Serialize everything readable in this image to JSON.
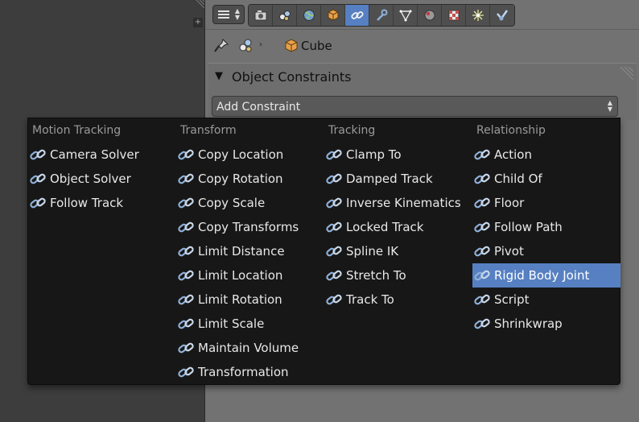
{
  "header": {
    "tabs": [
      {
        "icon": "render-icon"
      },
      {
        "icon": "render-layers-icon"
      },
      {
        "icon": "world-icon"
      },
      {
        "icon": "object-icon"
      },
      {
        "icon": "constraint-icon",
        "active": true
      },
      {
        "icon": "modifier-icon"
      },
      {
        "icon": "mesh-data-icon"
      },
      {
        "icon": "material-icon"
      },
      {
        "icon": "texture-icon"
      },
      {
        "icon": "particles-icon"
      },
      {
        "icon": "physics-icon"
      }
    ]
  },
  "breadcrumb": {
    "object_name": "Cube"
  },
  "panel": {
    "title": "Object Constraints",
    "add_constraint_label": "Add Constraint"
  },
  "menu": {
    "columns": [
      {
        "header": "Motion Tracking",
        "items": [
          "Camera Solver",
          "Object Solver",
          "Follow Track"
        ]
      },
      {
        "header": "Transform",
        "items": [
          "Copy Location",
          "Copy Rotation",
          "Copy Scale",
          "Copy Transforms",
          "Limit Distance",
          "Limit Location",
          "Limit Rotation",
          "Limit Scale",
          "Maintain Volume",
          "Transformation"
        ]
      },
      {
        "header": "Tracking",
        "items": [
          "Clamp To",
          "Damped Track",
          "Inverse Kinematics",
          "Locked Track",
          "Spline IK",
          "Stretch To",
          "Track To"
        ]
      },
      {
        "header": "Relationship",
        "items": [
          "Action",
          "Child Of",
          "Floor",
          "Follow Path",
          "Pivot",
          "Rigid Body Joint",
          "Script",
          "Shrinkwrap"
        ]
      }
    ],
    "highlighted_item": "Rigid Body Joint"
  },
  "colors": {
    "highlight": "#5680c2",
    "menu_bg": "#171717",
    "panel_bg": "#727272",
    "viewport_bg": "#3d3d3d"
  }
}
